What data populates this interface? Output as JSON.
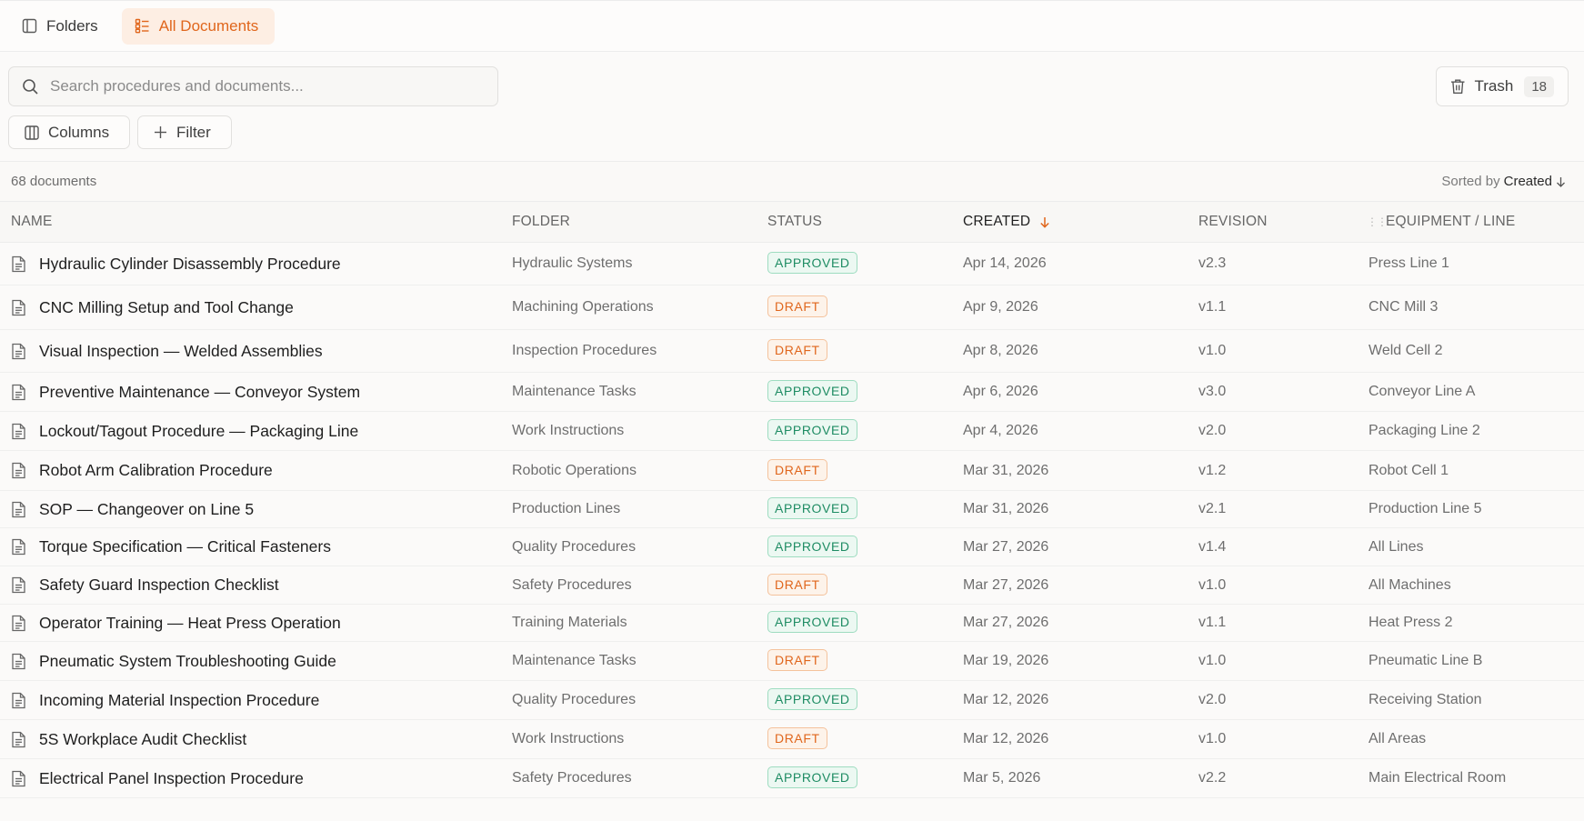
{
  "tabs": [
    {
      "label": "Folders",
      "active": false
    },
    {
      "label": "All Documents",
      "active": true
    }
  ],
  "search": {
    "placeholder": "Search procedures and documents..."
  },
  "toolbar": {
    "columns_label": "Columns",
    "filter_label": "Filter",
    "trash_label": "Trash",
    "trash_count": "18"
  },
  "summary": {
    "doc_count": "68 documents",
    "sorted_prefix": "Sorted by",
    "sorted_field": "Created"
  },
  "columns": {
    "name": "NAME",
    "folder": "FOLDER",
    "status": "STATUS",
    "created": "CREATED",
    "revision": "REVISION",
    "equipment": "EQUIPMENT / LINE"
  },
  "colors": {
    "accent": "#e0661c",
    "approved": "#1e8c63",
    "draft": "#e0661c"
  },
  "rows": [
    {
      "name": "Hydraulic Cylinder Disassembly Procedure",
      "folder": "Hydraulic Systems",
      "status": "APPROVED",
      "created": "Apr 14, 2026",
      "revision": "v2.3",
      "equipment": "Press Line 1"
    },
    {
      "name": "CNC Milling Setup and Tool Change",
      "folder": "Machining Operations",
      "status": "DRAFT",
      "created": "Apr 9, 2026",
      "revision": "v1.1",
      "equipment": "CNC Mill 3"
    },
    {
      "name": "Visual Inspection — Welded Assemblies",
      "folder": "Inspection Procedures",
      "status": "DRAFT",
      "created": "Apr 8, 2026",
      "revision": "v1.0",
      "equipment": "Weld Cell 2"
    },
    {
      "name": "Preventive Maintenance — Conveyor System",
      "folder": "Maintenance Tasks",
      "status": "APPROVED",
      "created": "Apr 6, 2026",
      "revision": "v3.0",
      "equipment": "Conveyor Line A"
    },
    {
      "name": "Lockout/Tagout Procedure — Packaging Line",
      "folder": "Work Instructions",
      "status": "APPROVED",
      "created": "Apr 4, 2026",
      "revision": "v2.0",
      "equipment": "Packaging Line 2"
    },
    {
      "name": "Robot Arm Calibration Procedure",
      "folder": "Robotic Operations",
      "status": "DRAFT",
      "created": "Mar 31, 2026",
      "revision": "v1.2",
      "equipment": "Robot Cell 1"
    },
    {
      "name": "SOP — Changeover on Line 5",
      "folder": "Production Lines",
      "status": "APPROVED",
      "created": "Mar 31, 2026",
      "revision": "v2.1",
      "equipment": "Production Line 5"
    },
    {
      "name": "Torque Specification — Critical Fasteners",
      "folder": "Quality Procedures",
      "status": "APPROVED",
      "created": "Mar 27, 2026",
      "revision": "v1.4",
      "equipment": "All Lines"
    },
    {
      "name": "Safety Guard Inspection Checklist",
      "folder": "Safety Procedures",
      "status": "DRAFT",
      "created": "Mar 27, 2026",
      "revision": "v1.0",
      "equipment": "All Machines"
    },
    {
      "name": "Operator Training — Heat Press Operation",
      "folder": "Training Materials",
      "status": "APPROVED",
      "created": "Mar 27, 2026",
      "revision": "v1.1",
      "equipment": "Heat Press 2"
    },
    {
      "name": "Pneumatic System Troubleshooting Guide",
      "folder": "Maintenance Tasks",
      "status": "DRAFT",
      "created": "Mar 19, 2026",
      "revision": "v1.0",
      "equipment": "Pneumatic Line B"
    },
    {
      "name": "Incoming Material Inspection Procedure",
      "folder": "Quality Procedures",
      "status": "APPROVED",
      "created": "Mar 12, 2026",
      "revision": "v2.0",
      "equipment": "Receiving Station"
    },
    {
      "name": "5S Workplace Audit Checklist",
      "folder": "Work Instructions",
      "status": "DRAFT",
      "created": "Mar 12, 2026",
      "revision": "v1.0",
      "equipment": "All Areas"
    },
    {
      "name": "Electrical Panel Inspection Procedure",
      "folder": "Safety Procedures",
      "status": "APPROVED",
      "created": "Mar 5, 2026",
      "revision": "v2.2",
      "equipment": "Main Electrical Room"
    }
  ]
}
